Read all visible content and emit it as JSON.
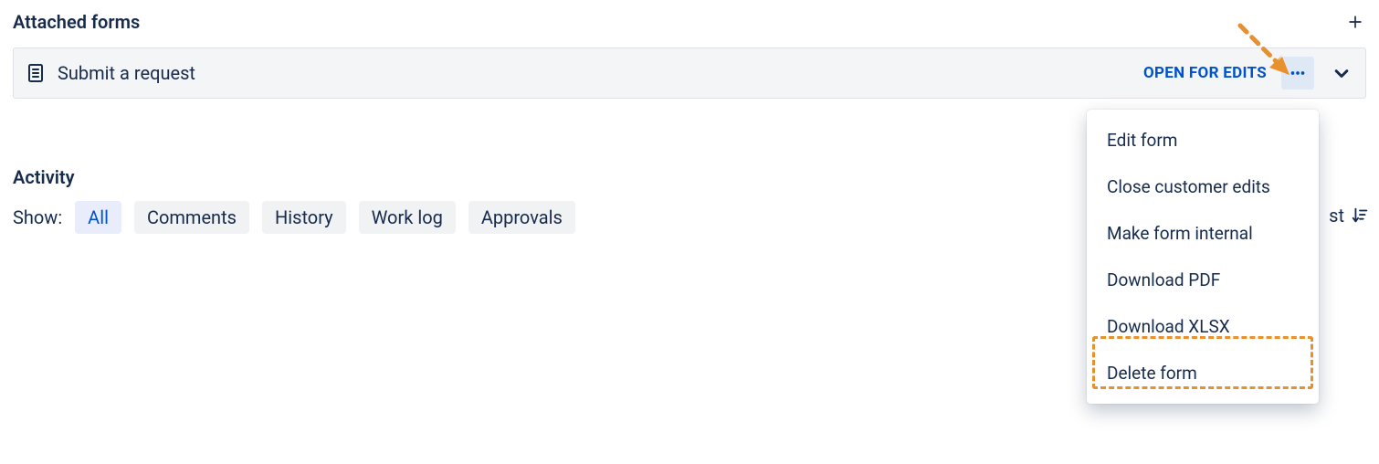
{
  "sections": {
    "attached_forms_title": "Attached forms",
    "activity_title": "Activity"
  },
  "form_row": {
    "title": "Submit a request",
    "status_label": "OPEN FOR EDITS"
  },
  "activity": {
    "show_label": "Show:",
    "tabs": {
      "all": "All",
      "comments": "Comments",
      "history": "History",
      "work_log": "Work log",
      "approvals": "Approvals"
    },
    "sort_fragment": "st"
  },
  "dropdown": {
    "items": {
      "edit_form": "Edit form",
      "close_customer_edits": "Close customer edits",
      "make_internal": "Make form internal",
      "download_pdf": "Download PDF",
      "download_xlsx": "Download XLSX",
      "delete_form": "Delete form"
    }
  }
}
